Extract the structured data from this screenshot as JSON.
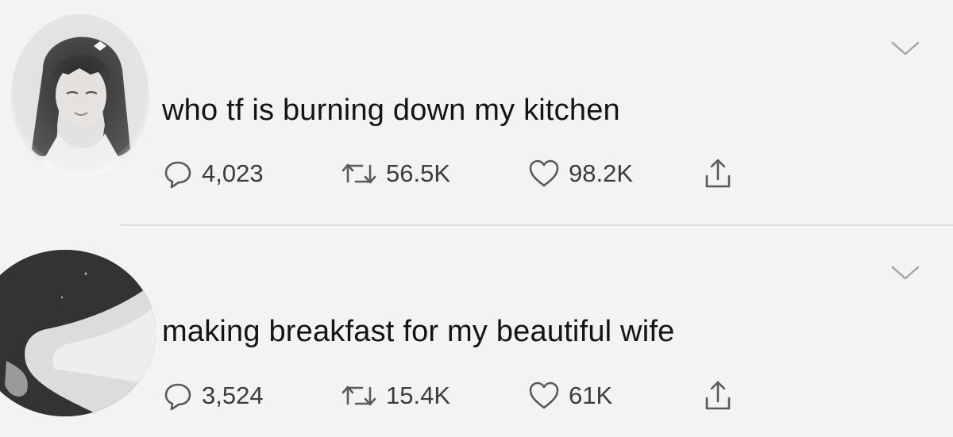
{
  "tweets": [
    {
      "text": "who tf is burning down my kitchen",
      "replies": "4,023",
      "retweets": "56.5K",
      "likes": "98.2K",
      "avatar_icon": "profile-photo-woman"
    },
    {
      "text": "making breakfast for my beautiful wife",
      "replies": "3,524",
      "retweets": "15.4K",
      "likes": "61K",
      "avatar_icon": "profile-photo-dark"
    }
  ],
  "icons": {
    "reply": "speech-bubble-icon",
    "retweet": "retweet-arrows-icon",
    "like": "heart-icon",
    "share": "share-upload-icon",
    "menu": "chevron-down-icon"
  },
  "colors": {
    "background": "#f3f3f4",
    "text": "#141414",
    "icon": "#5a5a5a",
    "divider": "#dcdcde"
  }
}
